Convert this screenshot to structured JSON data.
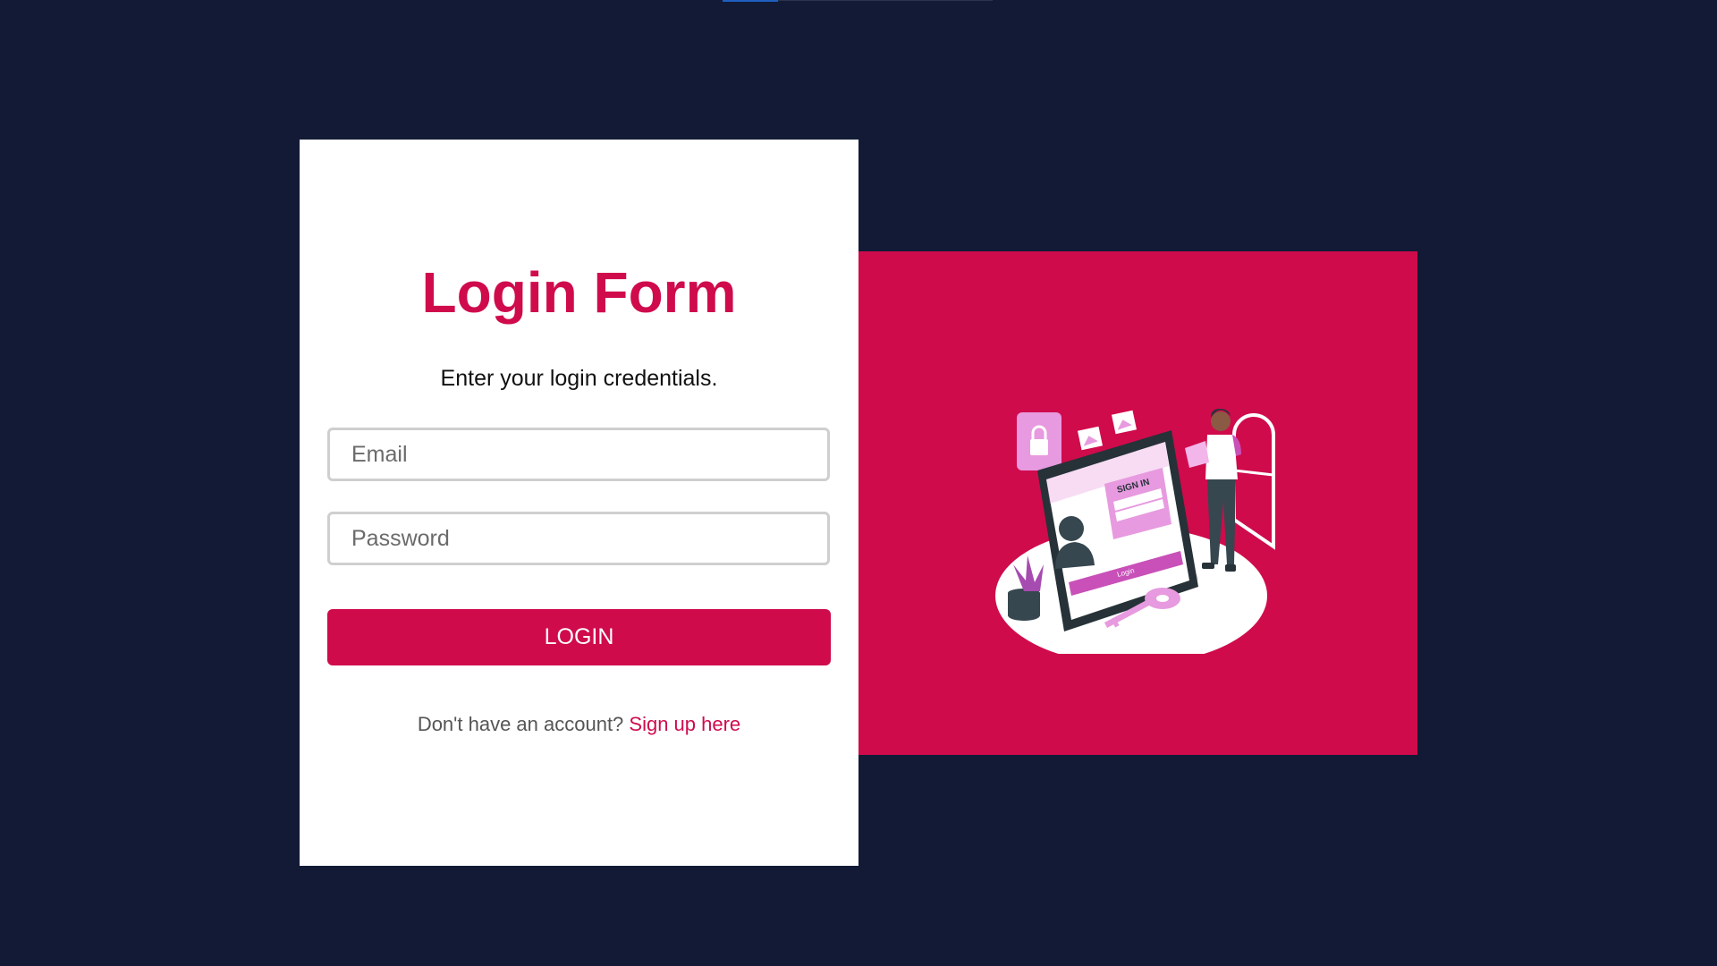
{
  "login": {
    "title": "Login Form",
    "subtitle": "Enter your login credentials.",
    "email_placeholder": "Email",
    "password_placeholder": "Password",
    "login_label": "LOGIN",
    "signup_prompt": "Don't have an account? ",
    "signup_link": "Sign up here"
  },
  "illustration": {
    "signin_label": "SIGN IN",
    "login_label": "Login"
  },
  "colors": {
    "background": "#121a35",
    "accent": "#cf0b4c",
    "card": "#ffffff",
    "field_border": "#cfcfcf"
  },
  "icons": [
    "lock-icon",
    "image-icon",
    "user-icon",
    "key-icon",
    "plant-icon",
    "person-icon"
  ]
}
